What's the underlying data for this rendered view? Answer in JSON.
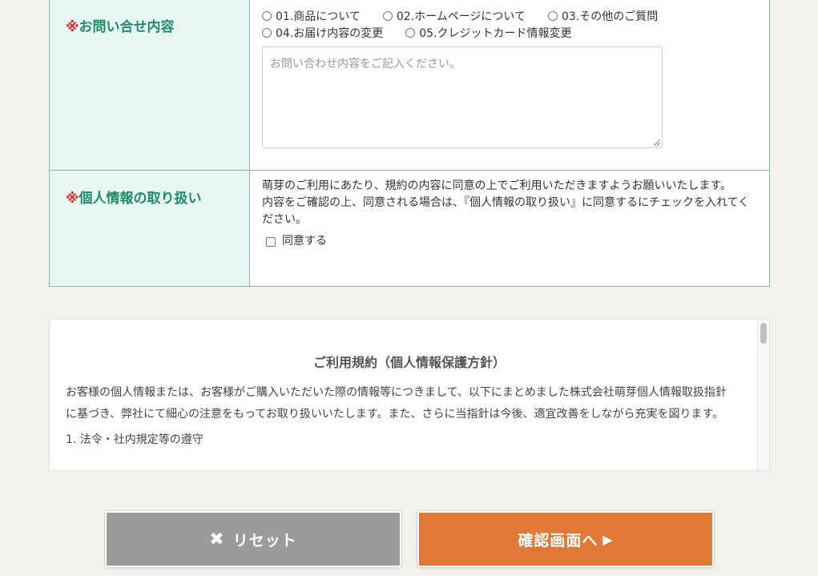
{
  "inquiry": {
    "label_mark": "※",
    "label": "お問い合せ内容",
    "options": [
      "01.商品について",
      "02.ホームページについて",
      "03.その他のご質問",
      "04.お届け内容の変更",
      "05.クレジットカード情報変更"
    ],
    "textarea_placeholder": "お問い合わせ内容をご記入ください。"
  },
  "privacy": {
    "label_mark": "※",
    "label": "個人情報の取り扱い",
    "text1": "萌芽のご利用にあたり、規約の内容に同意の上でご利用いただきますようお願いいたします。",
    "text2": "内容をご確認の上、同意される場合は、『個人情報の取り扱い』に同意するにチェックを入れてください。",
    "agree_label": "同意する"
  },
  "terms": {
    "title": "ご利用規約（個人情報保護方針）",
    "body": "お客様の個人情報または、お客様がご購入いただいた際の情報等につきまして、以下にまとめました株式会社萌芽個人情報取扱指針に基づき、弊社にて細心の注意をもってお取り扱いいたします。また、さらに当指針は今後、適宜改善をしながら充実を図ります。",
    "item1": "1. 法令・社内規定等の遵守"
  },
  "buttons": {
    "reset_label": "リセット",
    "confirm_label": "確認画面へ"
  }
}
